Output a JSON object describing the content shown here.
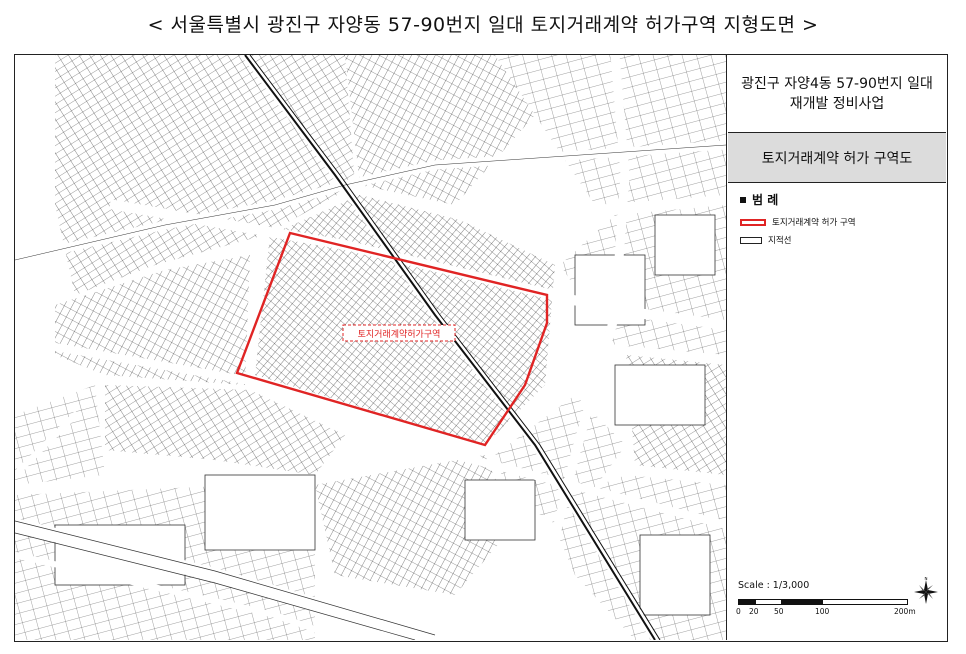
{
  "page": {
    "title": "< 서울특별시 광진구 자양동 57-90번지 일대 토지거래계약 허가구역 지형도면 >"
  },
  "panel": {
    "project_line1": "광진구 자양4동 57-90번지 일대",
    "project_line2": "재개발 정비사업",
    "map_name": "토지거래계약 허가 구역도",
    "legend_title": "범 례",
    "legend_items": [
      {
        "label": "토지거래계약 허가 구역",
        "color": "#e02424"
      },
      {
        "label": "지적선",
        "color": "#222222"
      }
    ],
    "scale_label": "Scale : 1/3,000",
    "scale_ticks": [
      "0",
      "20",
      "50",
      "100",
      "200m"
    ]
  },
  "map": {
    "area_label": "토지거래계약허가구역",
    "compass_label": "N",
    "colors": {
      "boundary": "#e02424",
      "parcel": "#333333",
      "road": "#ffffff",
      "rail": "#111111"
    }
  }
}
